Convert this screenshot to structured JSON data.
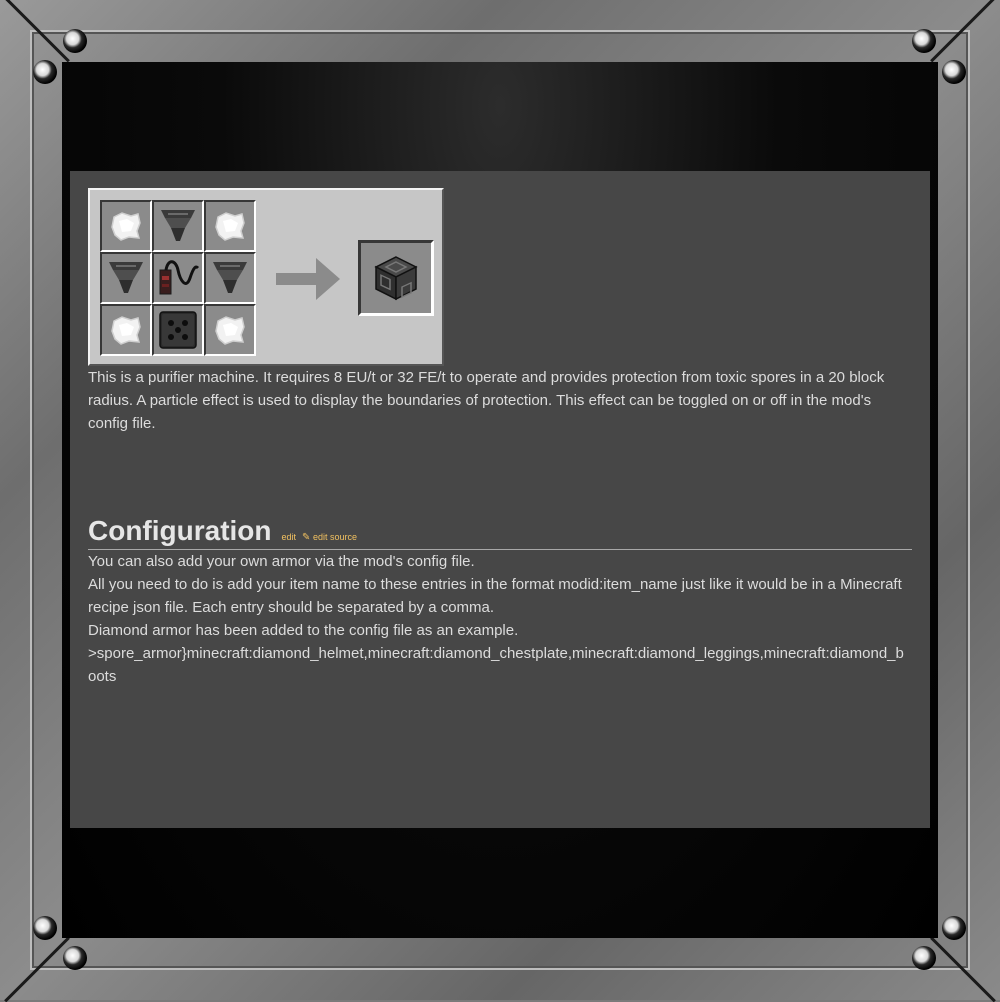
{
  "recipe": {
    "grid": [
      [
        "wool-icon",
        "funnel-icon",
        "wool-icon"
      ],
      [
        "funnel-icon",
        "battery-cable-icon",
        "funnel-icon"
      ],
      [
        "wool-icon",
        "machine-casing-icon",
        "wool-icon"
      ]
    ],
    "arrow_icon": "arrow-right-icon",
    "output_icon": "purifier-block-icon"
  },
  "description": "This is a purifier machine. It requires 8 EU/t or 32 FE/t to operate and provides protection from toxic spores in a 20 block radius. A particle effect is used to display the boundaries of protection. This effect can be toggled on or off in the mod's config file.",
  "section": {
    "title": "Configuration",
    "edit_label": "edit",
    "edit_source_label": "edit source"
  },
  "paragraphs": {
    "p1": "You can also add your own armor via the mod's config file.",
    "p2": "All you need to do is add your item name to these entries in the format modid:item_name just like it would be in a Minecraft recipe json file. Each entry should be separated by a comma.",
    "p3": "Diamond armor has been added to the config file as an example.",
    "p4": ">spore_armor}minecraft:diamond_helmet,minecraft:diamond_chestplate,minecraft:diamond_leggings,minecraft:diamond_boots"
  },
  "colors": {
    "panel": "#474747",
    "link": "#f0c060",
    "text": "#dcdcdc"
  }
}
